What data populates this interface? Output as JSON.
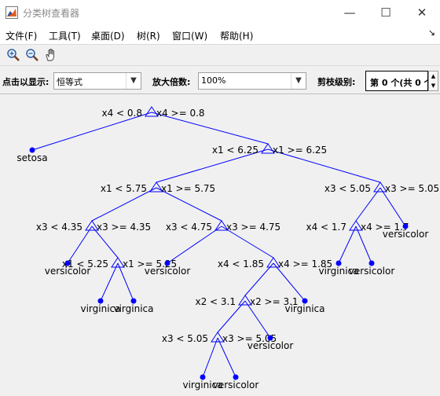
{
  "window": {
    "title": "分类树查看器",
    "minimize_glyph": "—",
    "maximize_glyph": "☐",
    "close_glyph": "✕"
  },
  "menu": {
    "items": [
      "文件(F)",
      "工具(T)",
      "桌面(D)",
      "树(R)",
      "窗口(W)",
      "帮助(H)"
    ],
    "overflow_glyph": "↘"
  },
  "toolbar": {
    "tools": [
      "zoom-in-icon",
      "zoom-out-icon",
      "pan-hand-icon"
    ]
  },
  "options": {
    "click_label": "点击以显示:",
    "click_value": "恒等式",
    "magnify_label": "放大倍数:",
    "magnify_value": "100%",
    "prune_label": "剪枝级别:",
    "prune_value": "第 0 个(共 0 个)"
  },
  "tree": {
    "line_color": "#0000ff",
    "node_color": "#0000ff",
    "splits": [
      {
        "left": "x4 < 0.8",
        "right": "x4 >= 0.8"
      },
      {
        "left": "x1 < 6.25",
        "right": "x1 >= 6.25"
      },
      {
        "left": "x1 < 5.75",
        "right": "x1 >= 5.75"
      },
      {
        "left": "x3 < 5.05",
        "right": "x3 >= 5.05"
      },
      {
        "left": "x3 < 4.35",
        "right": "x3 >= 4.35"
      },
      {
        "left": "x3 < 4.75",
        "right": "x3 >= 4.75"
      },
      {
        "left": "x4 < 1.7",
        "right": "x4 >= 1.7"
      },
      {
        "left": "x1 < 5.25",
        "right": "x1 >= 5.25"
      },
      {
        "left": "x4 < 1.85",
        "right": "x4 >= 1.85"
      },
      {
        "left": "x2 < 3.1",
        "right": "x2 >= 3.1"
      },
      {
        "left": "x3 < 5.05",
        "right": "x3 >= 5.05"
      }
    ],
    "leaves": [
      "setosa",
      "virginica",
      "versicolor",
      "versicolor",
      "versicolor",
      "virginica",
      "virginica",
      "versicolor",
      "virginica",
      "versicolor",
      "virginica",
      "versicolor"
    ]
  }
}
